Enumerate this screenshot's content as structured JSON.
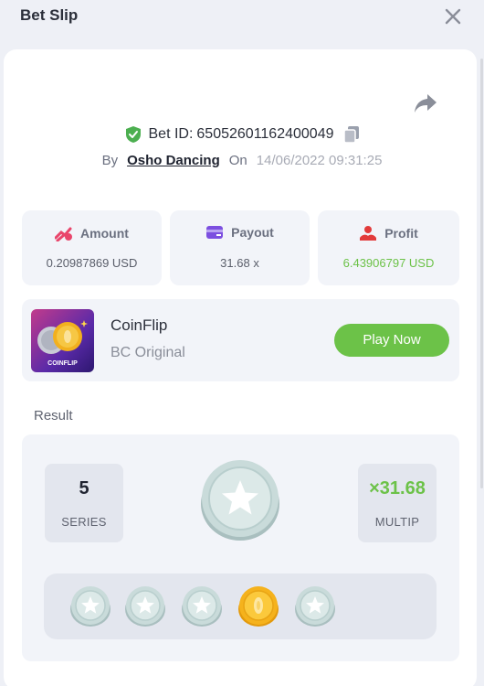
{
  "header": {
    "title": "Bet Slip",
    "close_icon": "close-icon"
  },
  "bet": {
    "id_label": "Bet ID:",
    "id_value": "65052601162400049",
    "by_label": "By",
    "author": "Osho Dancing",
    "on_label": "On",
    "timestamp": "14/06/2022 09:31:25"
  },
  "stats": [
    {
      "label": "Amount",
      "value": "0.20987869 USD",
      "icon": "amount-icon",
      "color": "#e9456b"
    },
    {
      "label": "Payout",
      "value": "31.68 x",
      "icon": "payout-icon",
      "color": "#7c4fe0"
    },
    {
      "label": "Profit",
      "value": "6.43906797 USD",
      "icon": "profit-icon",
      "color": "#e23b3b"
    }
  ],
  "game": {
    "name": "CoinFlip",
    "provider": "BC Original",
    "thumb_caption": "COINFLIP",
    "play_label": "Play Now"
  },
  "result": {
    "section_label": "Result",
    "series_value": "5",
    "series_label": "SERIES",
    "multiplier_value": "×31.68",
    "multiplier_label": "MULTIP",
    "main_coin": "silver",
    "history": [
      "silver",
      "silver",
      "silver",
      "gold",
      "silver"
    ]
  },
  "colors": {
    "accent_green": "#6cc248",
    "panel_bg": "#f2f4f9",
    "page_bg": "#eef0f6"
  }
}
